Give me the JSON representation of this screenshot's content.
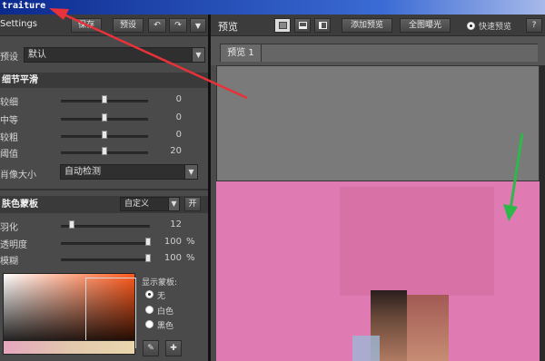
{
  "window": {
    "title": "traiture"
  },
  "left": {
    "header": "Settings",
    "save": "保存",
    "preset": "预设",
    "undo_icon": "undo-icon",
    "redo_icon": "redo-icon",
    "preset_label": "预设",
    "preset_value": "默认",
    "detail": {
      "title": "细节平滑",
      "sliders": [
        {
          "label": "较细",
          "value": "0",
          "level": 0.5
        },
        {
          "label": "中等",
          "value": "0",
          "level": 0.5
        },
        {
          "label": "较粗",
          "value": "0",
          "level": 0.5
        },
        {
          "label": "阈值",
          "value": "20",
          "level": 0.5
        }
      ],
      "portrait_label": "肖像大小",
      "portrait_value": "自动检测"
    },
    "mask": {
      "title": "肤色蒙板",
      "mode": "自定义",
      "toggle": "开",
      "sliders": [
        {
          "label": "羽化",
          "value": "12",
          "unit": "",
          "level": 0.12
        },
        {
          "label": "透明度",
          "value": "100",
          "unit": "%",
          "level": 1.0
        },
        {
          "label": "模糊",
          "value": "100",
          "unit": "%",
          "level": 1.0
        }
      ],
      "display_label": "显示蒙板:",
      "options": [
        "无",
        "白色",
        "黑色"
      ],
      "selected": "无"
    }
  },
  "preview": {
    "title": "预览",
    "add_preview": "添加预览",
    "exposure": "全图曝光",
    "quick_preview": "快速预览",
    "tab": "预览 1"
  },
  "colors": {
    "arrow_red": "#e8323a",
    "arrow_green": "#2fb84a",
    "pink": "#d96aa8"
  }
}
